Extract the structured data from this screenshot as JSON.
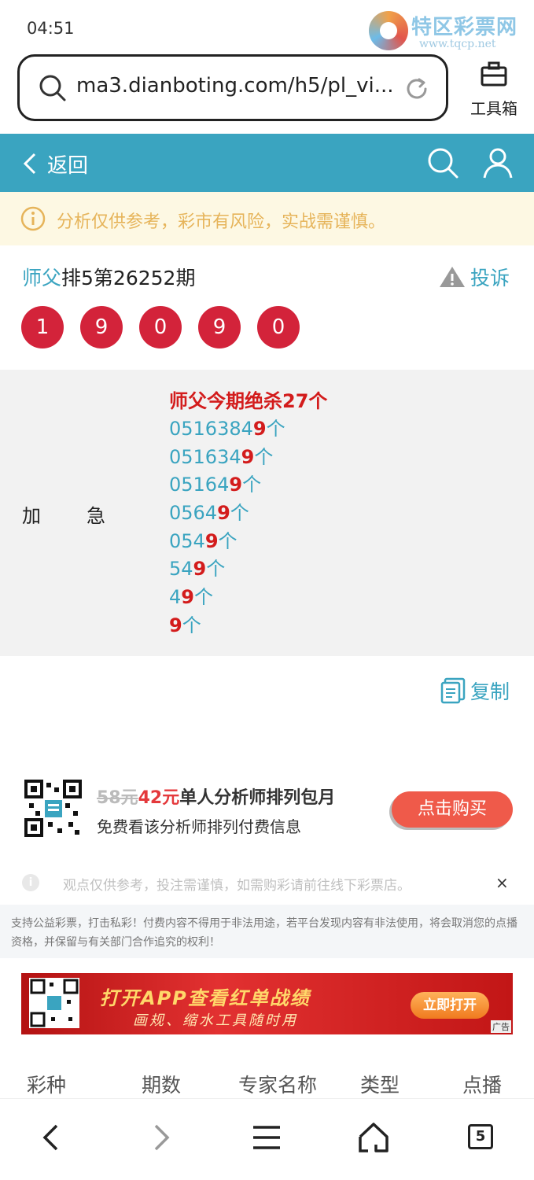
{
  "status_bar": {
    "time": "04:51"
  },
  "watermark": {
    "title": "特区彩票网",
    "url": "www.tqcp.net"
  },
  "browser": {
    "url": "ma3.dianboting.com/h5/pl_vi...",
    "toolbox_label": "工具箱"
  },
  "header": {
    "back_label": "返回"
  },
  "notice": {
    "text": "分析仅供参考，彩市有风险，实战需谨慎。"
  },
  "period": {
    "master": "师父",
    "rest": "排5第26252期",
    "complain_label": "投诉"
  },
  "balls": [
    "1",
    "9",
    "0",
    "9",
    "0"
  ],
  "content": {
    "left_label_a": "加",
    "left_label_b": "急",
    "kill_title": "师父今期绝杀27个",
    "lines": [
      {
        "prefix": "0516384",
        "hl": "9",
        "suffix": "个"
      },
      {
        "prefix": "051634",
        "hl": "9",
        "suffix": "个"
      },
      {
        "prefix": "05164",
        "hl": "9",
        "suffix": "个"
      },
      {
        "prefix": "0564",
        "hl": "9",
        "suffix": "个"
      },
      {
        "prefix": "054",
        "hl": "9",
        "suffix": "个"
      },
      {
        "prefix": "54",
        "hl": "9",
        "suffix": "个"
      },
      {
        "prefix": "4",
        "hl": "9",
        "suffix": "个"
      },
      {
        "prefix": "",
        "hl": "9",
        "suffix": "个"
      }
    ]
  },
  "copy_label": "复制",
  "promo": {
    "old_price": "58元",
    "new_price": "42元",
    "title": "单人分析师排列包月",
    "subtitle": "免费看该分析师排列付费信息",
    "buy_label": "点击购买"
  },
  "disclaimer": {
    "text": "观点仅供参考，投注需谨慎，如需购彩请前往线下彩票店。",
    "close": "×",
    "legal": "支持公益彩票，打击私彩！付费内容不得用于非法用途，若平台发现内容有非法使用，将会取消您的点播资格，并保留与有关部门合作追究的权利！"
  },
  "banner": {
    "title": "打开APP查看红单战绩",
    "subtitle": "画规、缩水工具随时用",
    "button": "立即打开",
    "ad_tag": "广告"
  },
  "table_header": [
    "彩种",
    "期数",
    "专家名称",
    "类型",
    "点播"
  ],
  "bottom_nav": {
    "tab_count": "5"
  },
  "colors": {
    "accent": "#3aa4c0",
    "ball_red": "#d3233a",
    "highlight_red": "#d31c1c",
    "notice_bg": "#fdf8e3"
  }
}
